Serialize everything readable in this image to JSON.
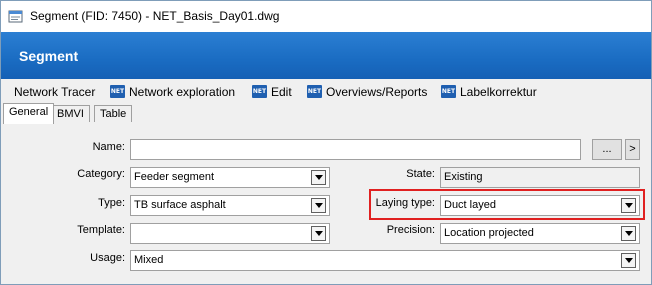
{
  "window": {
    "title": "Segment (FID: 7450) - NET_Basis_Day01.dwg"
  },
  "banner": {
    "title": "Segment"
  },
  "menu": {
    "items": [
      {
        "label": "Network Tracer",
        "icon": ""
      },
      {
        "label": "Network exploration",
        "icon": "NET"
      },
      {
        "label": "Edit",
        "icon": "NET"
      },
      {
        "label": "Overviews/Reports",
        "icon": "NET"
      },
      {
        "label": "Labelkorrektur",
        "icon": "NET"
      }
    ]
  },
  "tabs": [
    {
      "label": "General",
      "active": true
    },
    {
      "label": "BMVI",
      "active": false
    },
    {
      "label": "Table",
      "active": false
    }
  ],
  "form": {
    "name": {
      "label": "Name:",
      "value": ""
    },
    "browse_label": "...",
    "next_label": ">",
    "category": {
      "label": "Category:",
      "value": "Feeder segment"
    },
    "state": {
      "label": "State:",
      "value": "Existing"
    },
    "type": {
      "label": "Type:",
      "value": "TB surface asphalt"
    },
    "laying_type": {
      "label": "Laying type:",
      "value": "Duct layed"
    },
    "template": {
      "label": "Template:",
      "value": ""
    },
    "precision": {
      "label": "Precision:",
      "value": "Location projected"
    },
    "usage": {
      "label": "Usage:",
      "value": "Mixed"
    }
  },
  "colors": {
    "banner": "#1a6cc2",
    "highlight": "#e02020",
    "net_icon": "#1f5fb0"
  }
}
